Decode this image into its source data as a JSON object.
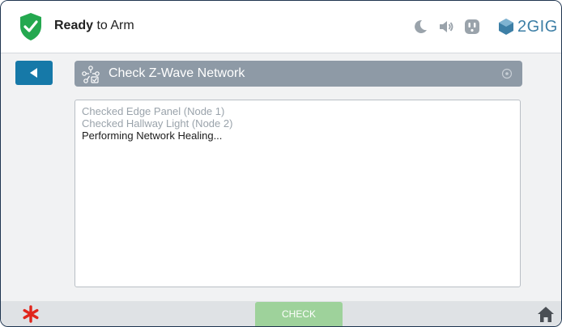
{
  "header": {
    "status_bold": "Ready",
    "status_rest": " to Arm",
    "brand": "2GIG",
    "icons": [
      "shield-check-icon",
      "moon-icon",
      "speaker-icon",
      "outlet-icon",
      "brand-logo-icon"
    ]
  },
  "nav": {
    "back_icon": "back-arrow-icon",
    "title": "Check Z-Wave Network",
    "title_icon": "zwave-network-icon",
    "option_icon": "circle-dot-icon"
  },
  "log": {
    "lines": [
      {
        "text": "Checked Edge Panel (Node 1)",
        "state": "done"
      },
      {
        "text": "Checked Hallway Light (Node 2)",
        "state": "done"
      },
      {
        "text": "Performing Network Healing...",
        "state": "active"
      }
    ]
  },
  "footer": {
    "check_label": "CHECK",
    "panic_icon": "emergency-asterisk-icon",
    "home_icon": "home-icon"
  },
  "colors": {
    "accent_blue": "#1679a8",
    "shield_green": "#24a84f",
    "title_bar_gray": "#8e9aa6",
    "check_green": "#9ed29b",
    "emergency_red": "#e1261c"
  }
}
